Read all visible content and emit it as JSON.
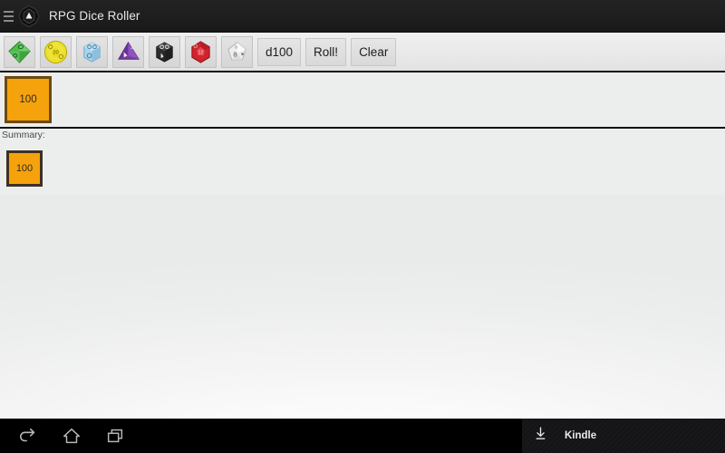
{
  "titlebar": {
    "menu_icon": "hamburger-menu-icon",
    "app_icon": "d20-die-icon",
    "title": "RPG Dice Roller"
  },
  "toolbar": {
    "dice_buttons": [
      {
        "name": "d4-dice-button",
        "icon": "green-octahedron-die-icon",
        "color": "#49b849"
      },
      {
        "name": "d20-dice-button",
        "icon": "yellow-icosahedron-die-icon",
        "color": "#ece02a"
      },
      {
        "name": "d6-dice-button",
        "icon": "lightblue-cube-die-icon",
        "color": "#a8d4ec"
      },
      {
        "name": "d4b-dice-button",
        "icon": "purple-tetrahedron-die-icon",
        "color": "#7a3fa8"
      },
      {
        "name": "d6b-dice-button",
        "icon": "black-cube-die-icon",
        "color": "#2c2c2c"
      },
      {
        "name": "d12-dice-button",
        "icon": "red-dodecahedron-die-icon",
        "color": "#d0232b"
      },
      {
        "name": "d10-dice-button",
        "icon": "white-pentagonal-die-icon",
        "color": "#e8e8e8"
      }
    ],
    "d100_label": "d100",
    "roll_label": "Roll!",
    "clear_label": "Clear"
  },
  "results": {
    "dice": [
      {
        "value": "100"
      }
    ]
  },
  "summary": {
    "label": "Summary:",
    "totals": [
      {
        "value": "100"
      }
    ]
  },
  "navbar": {
    "back_icon": "back-arrow-icon",
    "home_icon": "home-icon",
    "recents_icon": "recent-apps-icon",
    "notification": {
      "icon": "download-icon",
      "label": "Kindle"
    }
  },
  "colors": {
    "die_fill": "#f6a20c",
    "die_border": "#6b4a10",
    "summary_border": "#3d3122",
    "titlebar": "#1e1e1e",
    "toolbar": "#e9e9e9",
    "navbar": "#000000"
  }
}
